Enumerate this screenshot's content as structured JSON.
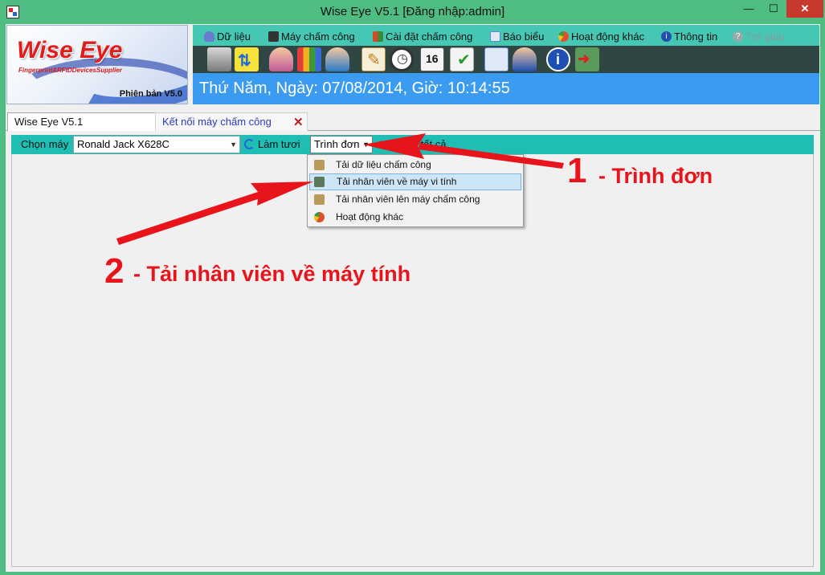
{
  "window": {
    "title": "Wise Eye V5.1 [Đăng nhập:admin]",
    "min": "—",
    "max": "☐",
    "close": "✕"
  },
  "logo": {
    "name": "Wise Eye",
    "tagline": "Fingerprint&RFIDDevicesSupplier",
    "version": "Phiên bản V5.0"
  },
  "menu": [
    {
      "label": "Dữ liệu",
      "icon": "database-icon",
      "color": "#6a7bd0"
    },
    {
      "label": "Máy chấm công",
      "icon": "device-icon",
      "color": "#333333"
    },
    {
      "label": "Cài đặt chấm công",
      "icon": "settings-grid-icon",
      "color": "#d04a2a"
    },
    {
      "label": "Báo biểu",
      "icon": "report-icon",
      "color": "#5a8ad0"
    },
    {
      "label": "Hoạt động khác",
      "icon": "pie-icon",
      "color": "#e0502a"
    },
    {
      "label": "Thông tin",
      "icon": "info-icon",
      "color": "#1f4fb0"
    },
    {
      "label": "Trợ giúp",
      "icon": "help-icon",
      "color": "#9aa9a9"
    }
  ],
  "datetime": "Thứ Năm, Ngày: 07/08/2014, Giờ: 10:14:55",
  "tabs": {
    "main": "Wise Eye V5.1",
    "connect": "Kết nối máy chấm công",
    "close": "✕"
  },
  "subbar": {
    "choose_label": "Chọn máy",
    "machine": "Ronald Jack X628C",
    "refresh": "Làm tươi",
    "menu": "Trình đơn",
    "close_all": "Đóng tất cả"
  },
  "dropdown": [
    {
      "label": "Tải dữ liệu chấm công",
      "color": "#b89a5a"
    },
    {
      "label": "Tải nhân viên về máy vi tính",
      "color": "#5a7a5a"
    },
    {
      "label": "Tải nhân viên lên máy chấm công",
      "color": "#b89a5a"
    },
    {
      "label": "Hoạt động khác",
      "color": "#e0502a"
    }
  ],
  "annotations": {
    "n1": "1",
    "t1": "- Trình đơn",
    "n2": "2",
    "t2": "- Tải nhân viên về máy tính"
  },
  "colors": {
    "titlebar": "#4fbd82",
    "menubar": "#46c7b4",
    "toolbar": "#2f4642",
    "datebar": "#3a9bf0",
    "subbar": "#20bdb4",
    "annotation": "#e8141c"
  }
}
